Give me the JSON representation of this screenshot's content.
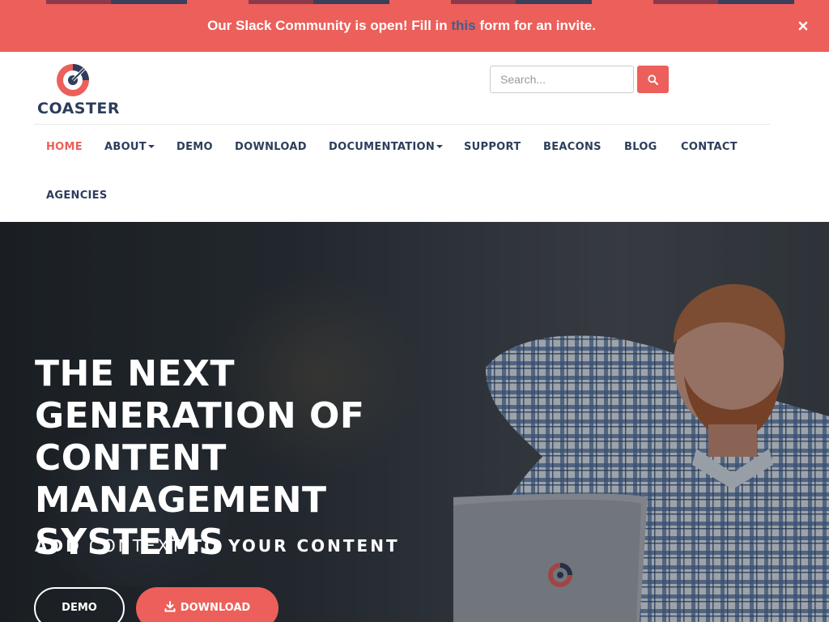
{
  "announcement": {
    "text_before": "Our Slack Community is open! Fill in ",
    "link_text": "this",
    "text_after": " form for an invite.",
    "close_icon": "close-icon",
    "tab_colors": [
      "#8a3a4a",
      "#3a3f5c"
    ]
  },
  "header": {
    "logo_text": "COASTER",
    "search": {
      "placeholder": "Search..."
    },
    "search_icon": "search-icon"
  },
  "nav": {
    "items": [
      {
        "label": "HOME",
        "active": true
      },
      {
        "label": "ABOUT",
        "dropdown": true
      },
      {
        "label": "DEMO"
      },
      {
        "label": "DOWNLOAD"
      },
      {
        "label": "DOCUMENTATION",
        "dropdown": true
      },
      {
        "label": "SUPPORT"
      },
      {
        "label": "BEACONS"
      },
      {
        "label": "BLOG"
      },
      {
        "label": "CONTACT"
      },
      {
        "label": "AGENCIES"
      }
    ]
  },
  "hero": {
    "headline": "The next generation of content management systems",
    "tagline": {
      "w1": "ADD",
      "w2": "CONTEXT",
      "w3": "TO YOUR CONTENT"
    },
    "demo_label": "DEMO",
    "download_label": "DOWNLOAD",
    "download_icon": "download-icon"
  },
  "colors": {
    "accent": "#ec5f5a",
    "navy": "#2e3d5c",
    "link": "#3f5f8f"
  }
}
